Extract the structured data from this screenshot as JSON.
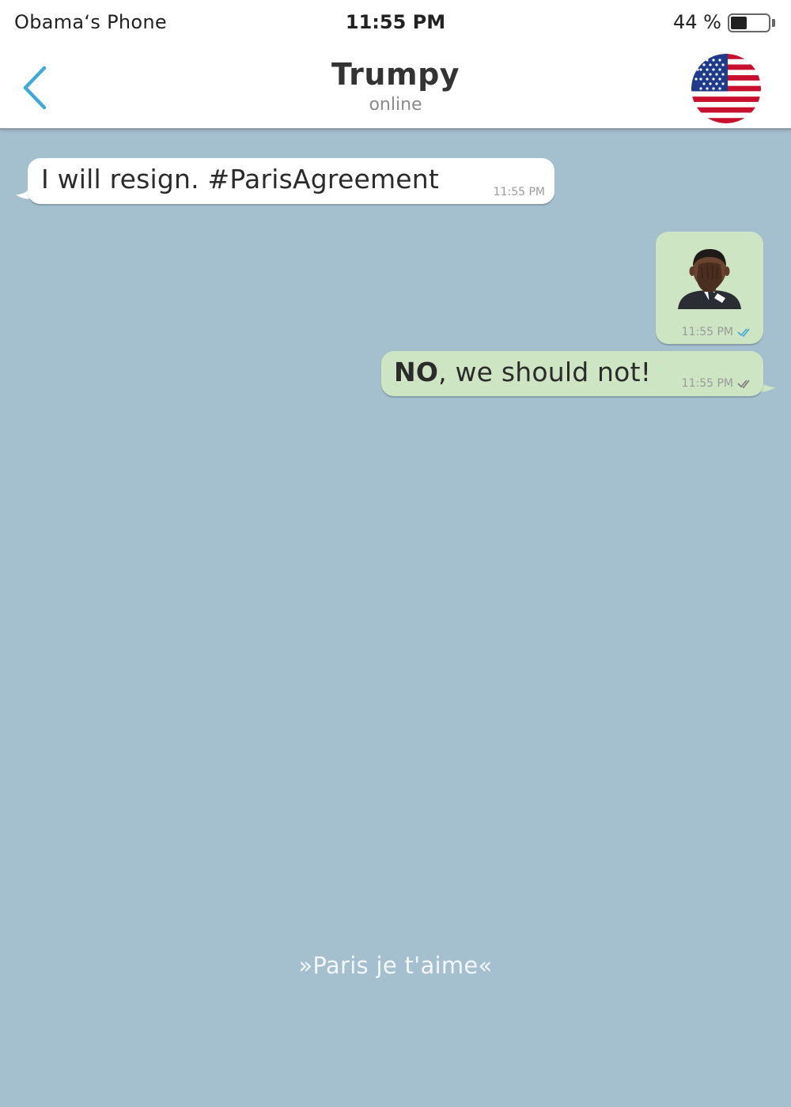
{
  "status_bar": {
    "carrier": "Obama‘s Phone",
    "time": "11:55 PM",
    "battery_percent_label": "44 %",
    "battery_level": 0.44
  },
  "header": {
    "back_icon": "chevron-left-icon",
    "contact_name": "Trumpy",
    "contact_status": "online",
    "avatar_icon": "us-flag-icon"
  },
  "messages": [
    {
      "direction": "incoming",
      "text": "I will resign. #ParisAgreement",
      "time": "11:55 PM"
    },
    {
      "direction": "outgoing",
      "type": "sticker",
      "sticker_icon": "facepalm-man-emoji-icon",
      "time": "11:55 PM",
      "status": "read",
      "tick_color": "#3fa9dc"
    },
    {
      "direction": "outgoing",
      "text_bold": "NO",
      "text_rest": ", we should not!",
      "time": "11:55 PM",
      "status": "delivered",
      "tick_color": "#7a7a7a"
    }
  ],
  "footer": {
    "slogan": "»Paris je t'aime«"
  },
  "colors": {
    "chat_background": "#a4bfce",
    "incoming_bubble": "#ffffff",
    "outgoing_bubble": "#cde5c3",
    "accent": "#3fa9dc"
  }
}
